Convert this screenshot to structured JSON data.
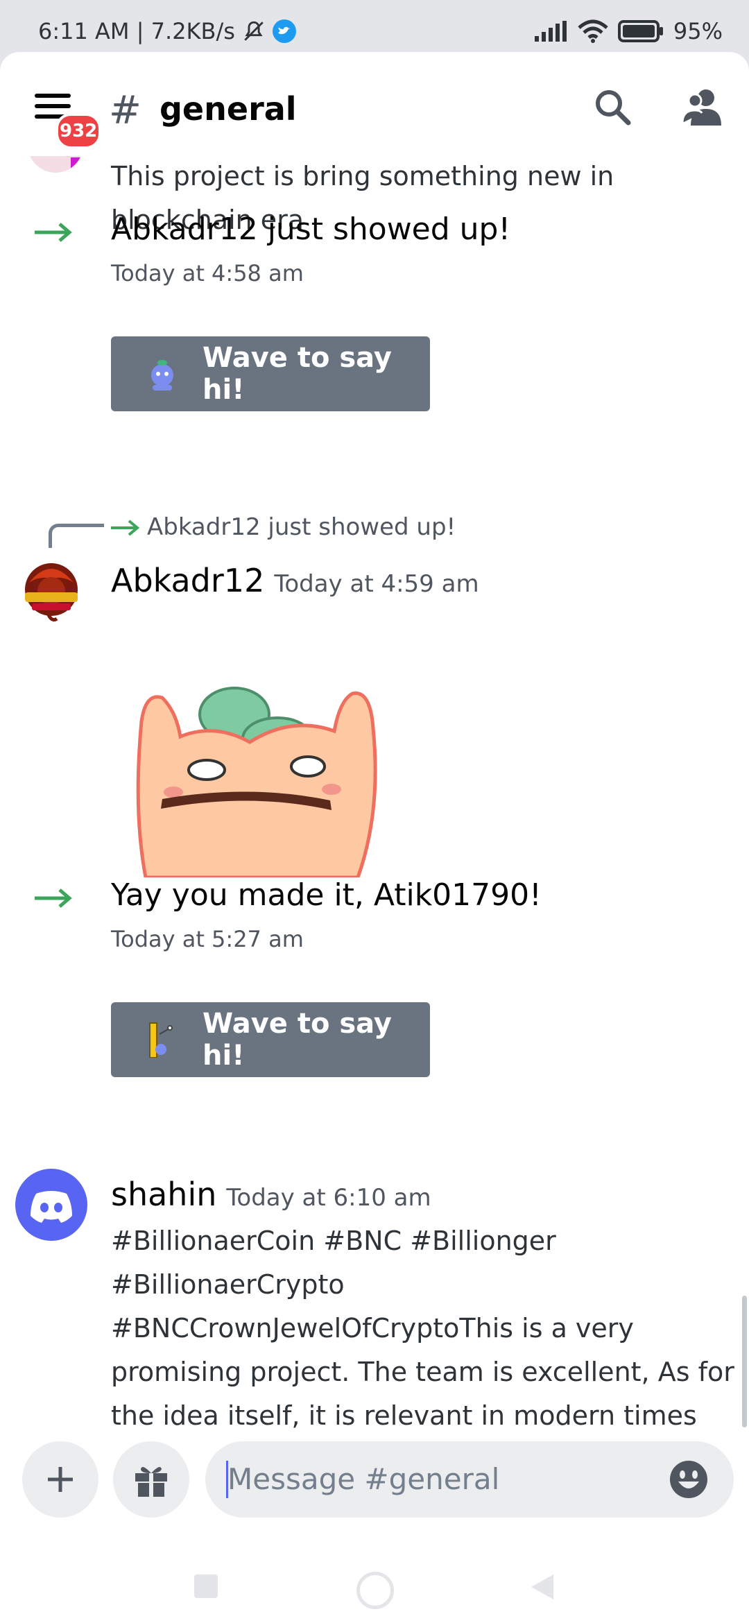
{
  "status_bar": {
    "time_info": "6:11 AM | 7.2KB/s",
    "battery": "95%"
  },
  "header": {
    "hash": "#",
    "channel": "general",
    "badge": "932"
  },
  "messages": {
    "prev_text_line1": "This project is bring something new in",
    "prev_text_line2": "blockchain era",
    "join1_text": "Abkadr12 just showed up!",
    "join1_time": "Today at 4:58 am",
    "wave_label": "Wave to say hi!",
    "reply_ref": "Abkadr12 just showed up!",
    "user1_name": "Abkadr12",
    "user1_time": "Today at 4:59 am",
    "join2_text": "Yay you made it, Atik01790!",
    "join2_time": "Today at 5:27 am",
    "wave_label2": "Wave to say hi!",
    "user2_name": "shahin",
    "user2_time": "Today at 6:10 am",
    "user2_lines": [
      "#BillionaerCoin #BNC #Billionger",
      "#BillionaerCrypto",
      "#BNCCrownJewelOfCryptoThis is a very",
      "promising project. The team is excellent, As for",
      "the idea itself, it is relevant in modern times"
    ]
  },
  "input": {
    "placeholder": "Message #general"
  },
  "colors": {
    "accent": "#5865f2",
    "join_arrow": "#3ba55c",
    "badge": "#ed4245",
    "wave_button": "#6a7480"
  }
}
